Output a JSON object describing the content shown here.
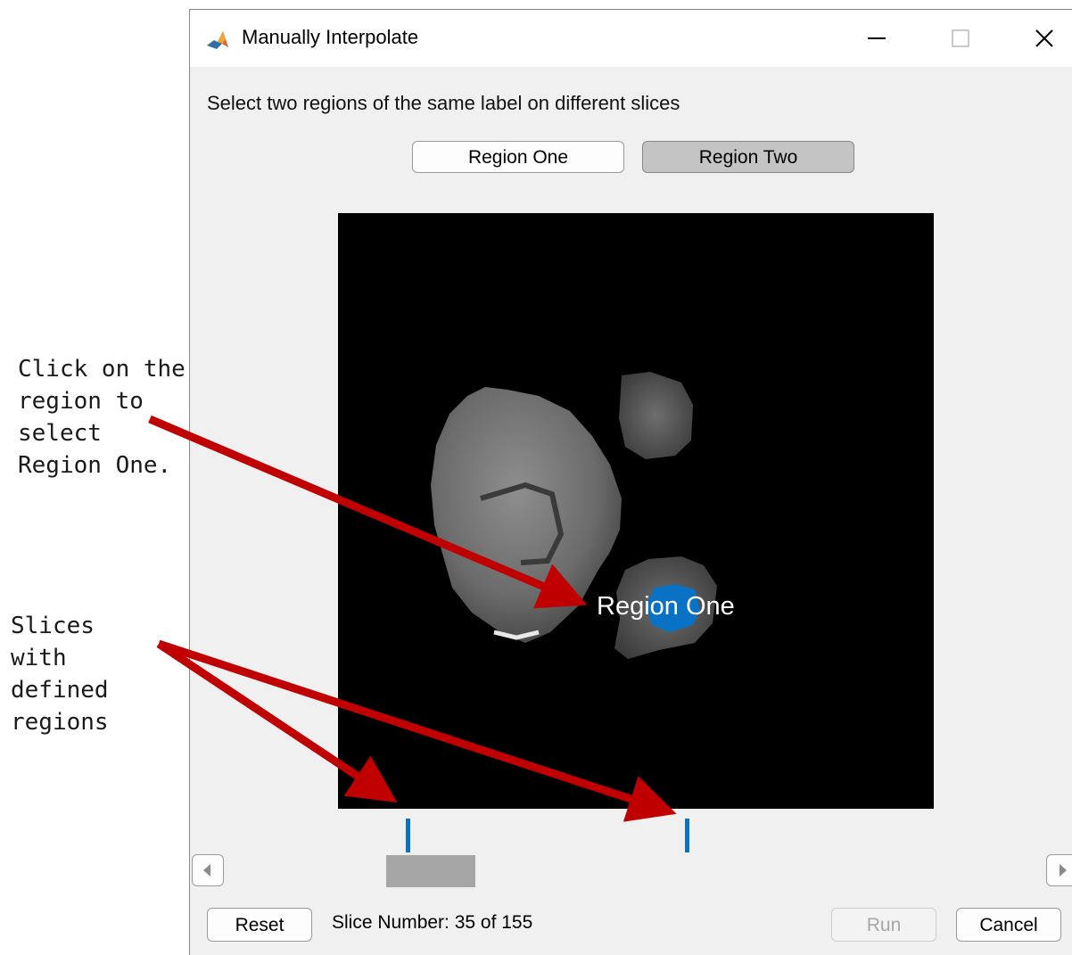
{
  "window": {
    "title": "Manually Interpolate",
    "app_icon": "matlab-logo-icon",
    "controls": {
      "minimize": "minimize-icon",
      "maximize": "maximize-icon",
      "close": "close-icon"
    }
  },
  "instruction": "Select two regions of the same label on different slices",
  "region_buttons": [
    {
      "label": "Region One",
      "selected": false
    },
    {
      "label": "Region Two",
      "selected": true
    }
  ],
  "viewer": {
    "region_label": "Region One",
    "region_color": "#0a72c4"
  },
  "slider": {
    "left_icon": "arrow-left-icon",
    "right_icon": "arrow-right-icon",
    "marker_color": "#0a72c4"
  },
  "footer": {
    "reset_label": "Reset",
    "slice_text": "Slice Number: 35 of 155",
    "run_label": "Run",
    "run_enabled": false,
    "cancel_label": "Cancel"
  },
  "annotations": {
    "click_note": [
      "Click on the",
      "region to",
      "select",
      "Region One."
    ],
    "slices_note": [
      "Slices with",
      "defined",
      "regions"
    ],
    "arrow_color": "#c00000"
  }
}
